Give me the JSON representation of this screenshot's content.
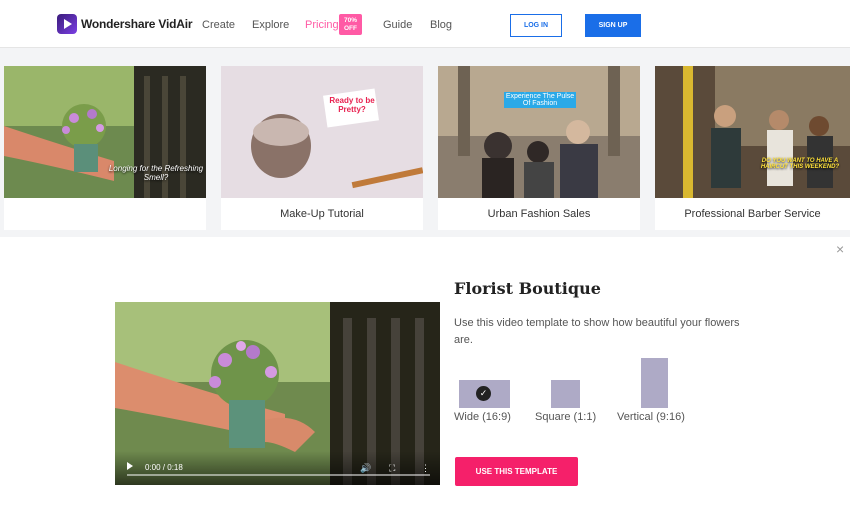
{
  "header": {
    "brand": "Wondershare VidAir",
    "nav": [
      "Create",
      "Explore",
      "Pricing",
      "Guide",
      "Blog"
    ],
    "pricing_badge": "70% OFF",
    "login_label": "LOG IN",
    "signup_label": "SIGN UP",
    "colors": {
      "accent": "#1a6ee8",
      "pricing": "#ff5aa5"
    }
  },
  "cards": [
    {
      "label": "",
      "overlay": "Longing for the Refreshing Smell?"
    },
    {
      "label": "Make-Up Tutorial",
      "overlay": "Ready to be Pretty?"
    },
    {
      "label": "Urban Fashion Sales",
      "overlay": "Experience The Pulse Of Fashion"
    },
    {
      "label": "Professional Barber Service",
      "overlay": "DO YOU WANT TO HAVE A HAIRCUT THIS WEEKEND?"
    }
  ],
  "detail": {
    "title": "Florist Boutique",
    "description": "Use this video template to show how beautiful your flowers are.",
    "video_time": "0:00 / 0:18",
    "ratios": [
      {
        "label": "Wide (16:9)",
        "selected": true
      },
      {
        "label": "Square (1:1)",
        "selected": false
      },
      {
        "label": "Vertical (9:16)",
        "selected": false
      }
    ],
    "use_button": "USE THIS TEMPLATE",
    "close_symbol": "×",
    "button_color": "#f5206a"
  }
}
